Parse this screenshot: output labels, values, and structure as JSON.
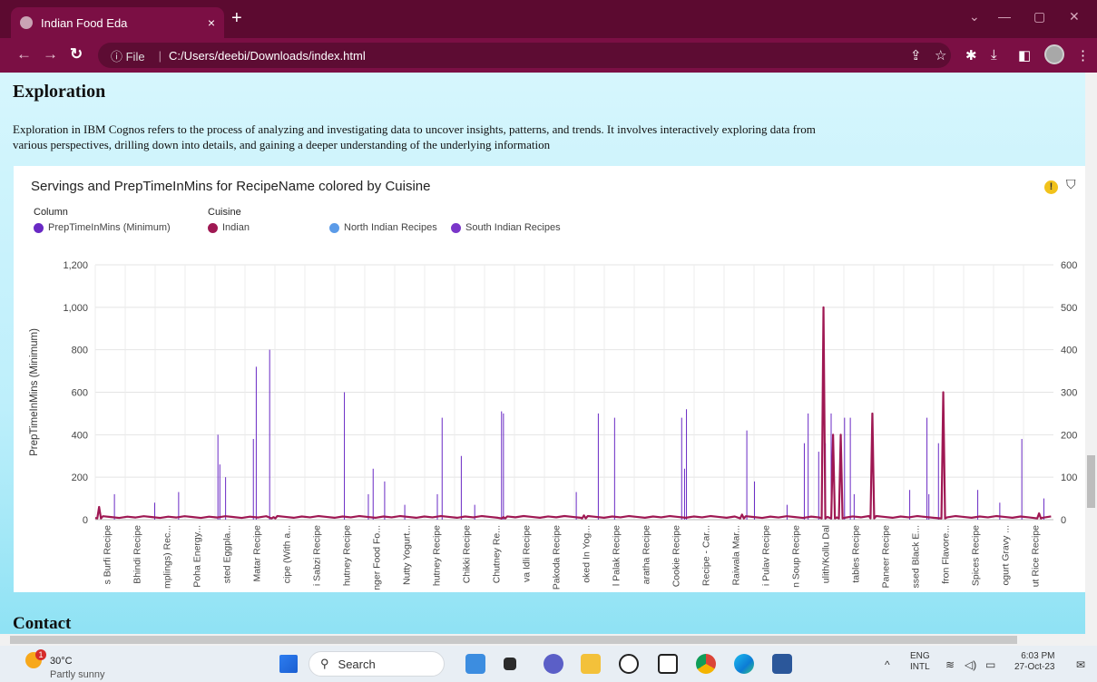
{
  "browser": {
    "tab_title": "Indian Food Eda",
    "tab_close": "×",
    "new_tab": "+",
    "url_info": "ⓘ File",
    "url": "C:/Users/deebi/Downloads/index.html"
  },
  "page": {
    "heading": "Exploration",
    "description": "Exploration in IBM Cognos refers to the process of analyzing and investigating data to uncover insights, patterns, and trends. It involves interactively exploring data from various perspectives, drilling down into details, and gaining a deeper understanding of the underlying information",
    "next_heading": "Contact"
  },
  "chart_card": {
    "title": "Servings and PrepTimeInMins for RecipeName colored by Cuisine",
    "legend_column_label": "Column",
    "legend_cuisine_label": "Cuisine",
    "legend_items": [
      {
        "label": "PrepTimeInMins (Minimum)",
        "color": "#6929c4"
      },
      {
        "label": "Indian",
        "color": "#9f1853"
      },
      {
        "label": "North Indian Recipes",
        "color": "#5b9be8"
      },
      {
        "label": "South Indian Recipes",
        "color": "#7a36c9"
      }
    ],
    "warning_icon": "!",
    "filter_icon": "⛉"
  },
  "chart_data": {
    "type": "line",
    "ylabel": "PrepTimeInMins (Minimum)",
    "y_left_ticks": [
      "1,200",
      "1,000",
      "800",
      "600",
      "400",
      "200",
      "0"
    ],
    "y_right_ticks": [
      "600",
      "500",
      "400",
      "300",
      "200",
      "100",
      "0"
    ],
    "ylim_left": [
      0,
      1200
    ],
    "ylim_right": [
      0,
      600
    ],
    "x_tick_labels": [
      "s Burfi Recipe",
      "Bhindi Recipe",
      "mplings) Rec...",
      "Poha Energy...",
      "sted Eggpla...",
      "Matar Recipe",
      "cipe (With a...",
      "i Sabzi Recipe",
      "hutney Recipe",
      "nger Food Fo...",
      "Nutty Yogurt...",
      "hutney Recipe",
      "Chikki Recipe",
      "Chutney Re...",
      "va Idli Recipe",
      "Pakoda Recipe",
      "oked In Yog...",
      "l Palak Recipe",
      "aratha Recipe",
      "Cookie Recipe",
      "Recipe - Car...",
      "Raiwala Mar...",
      "i Pulav Recipe",
      "n Soup Recipe",
      "ulith/Kollu Dal",
      "tables Recipe",
      "Paneer Recipe",
      "ssed Black E...",
      "fron Flavore...",
      "Spices Recipe",
      "ogurt Gravy ...",
      "ut Rice Recipe"
    ],
    "prep_time_spikes_minutes": [
      {
        "pos": 0.02,
        "value": 120
      },
      {
        "pos": 0.062,
        "value": 80
      },
      {
        "pos": 0.087,
        "value": 130
      },
      {
        "pos": 0.128,
        "value": 400
      },
      {
        "pos": 0.13,
        "value": 260
      },
      {
        "pos": 0.136,
        "value": 200
      },
      {
        "pos": 0.165,
        "value": 380
      },
      {
        "pos": 0.168,
        "value": 720
      },
      {
        "pos": 0.182,
        "value": 800
      },
      {
        "pos": 0.26,
        "value": 600
      },
      {
        "pos": 0.285,
        "value": 120
      },
      {
        "pos": 0.29,
        "value": 240
      },
      {
        "pos": 0.302,
        "value": 180
      },
      {
        "pos": 0.323,
        "value": 70
      },
      {
        "pos": 0.357,
        "value": 120
      },
      {
        "pos": 0.362,
        "value": 480
      },
      {
        "pos": 0.382,
        "value": 300
      },
      {
        "pos": 0.396,
        "value": 70
      },
      {
        "pos": 0.424,
        "value": 510
      },
      {
        "pos": 0.426,
        "value": 500
      },
      {
        "pos": 0.502,
        "value": 130
      },
      {
        "pos": 0.525,
        "value": 500
      },
      {
        "pos": 0.542,
        "value": 480
      },
      {
        "pos": 0.612,
        "value": 480
      },
      {
        "pos": 0.615,
        "value": 240
      },
      {
        "pos": 0.617,
        "value": 520
      },
      {
        "pos": 0.68,
        "value": 420
      },
      {
        "pos": 0.688,
        "value": 180
      },
      {
        "pos": 0.722,
        "value": 70
      },
      {
        "pos": 0.74,
        "value": 360
      },
      {
        "pos": 0.744,
        "value": 500
      },
      {
        "pos": 0.755,
        "value": 320
      },
      {
        "pos": 0.762,
        "value": 360
      },
      {
        "pos": 0.768,
        "value": 500
      },
      {
        "pos": 0.782,
        "value": 480
      },
      {
        "pos": 0.788,
        "value": 480
      },
      {
        "pos": 0.792,
        "value": 120
      },
      {
        "pos": 0.85,
        "value": 140
      },
      {
        "pos": 0.868,
        "value": 480
      },
      {
        "pos": 0.87,
        "value": 120
      },
      {
        "pos": 0.88,
        "value": 360
      },
      {
        "pos": 0.921,
        "value": 140
      },
      {
        "pos": 0.944,
        "value": 80
      },
      {
        "pos": 0.967,
        "value": 380
      },
      {
        "pos": 0.99,
        "value": 100
      }
    ],
    "servings_spikes": [
      {
        "pos": 0.004,
        "value": 30
      },
      {
        "pos": 0.186,
        "value": 6
      },
      {
        "pos": 0.426,
        "value": 6
      },
      {
        "pos": 0.51,
        "value": 10
      },
      {
        "pos": 0.675,
        "value": 12
      },
      {
        "pos": 0.76,
        "value": 500
      },
      {
        "pos": 0.77,
        "value": 200
      },
      {
        "pos": 0.778,
        "value": 200
      },
      {
        "pos": 0.811,
        "value": 250
      },
      {
        "pos": 0.885,
        "value": 300
      },
      {
        "pos": 0.985,
        "value": 15
      }
    ],
    "colors": {
      "prep": "#6929c4",
      "servings": "#9f1853"
    }
  },
  "taskbar": {
    "weather_temp": "30°C",
    "weather_condition": "Partly sunny",
    "weather_badge": "1",
    "search_label": "Search",
    "lang_line1": "ENG",
    "lang_line2": "INTL",
    "time": "6:03 PM",
    "date": "27-Oct-23"
  }
}
